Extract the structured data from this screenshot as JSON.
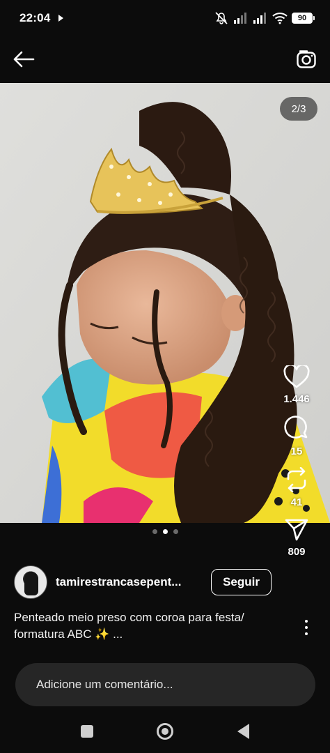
{
  "status_bar": {
    "time": "22:04",
    "battery": "90",
    "icons": [
      "media-play-icon",
      "mute-icon",
      "signal-icon",
      "signal-icon",
      "wifi-icon",
      "battery-icon"
    ]
  },
  "top_nav": {
    "back_icon": "back-arrow-icon",
    "camera_icon": "camera-icon"
  },
  "media": {
    "page_indicator": "2/3",
    "total_pages": 3,
    "current_page": 2
  },
  "actions": {
    "likes": "1.446",
    "comments": "15",
    "reposts": "41",
    "shares": "809"
  },
  "post": {
    "author": "tamirestrancasepent...",
    "follow_label": "Seguir",
    "caption_line1": "Penteado meio preso com coroa para festa/",
    "caption_line2": "formatura ABC ✨ ..."
  },
  "comment": {
    "placeholder": "Adicione um comentário..."
  },
  "colors": {
    "background": "#0c0c0c",
    "comment_box": "#262626",
    "accent_white": "#ffffff"
  }
}
